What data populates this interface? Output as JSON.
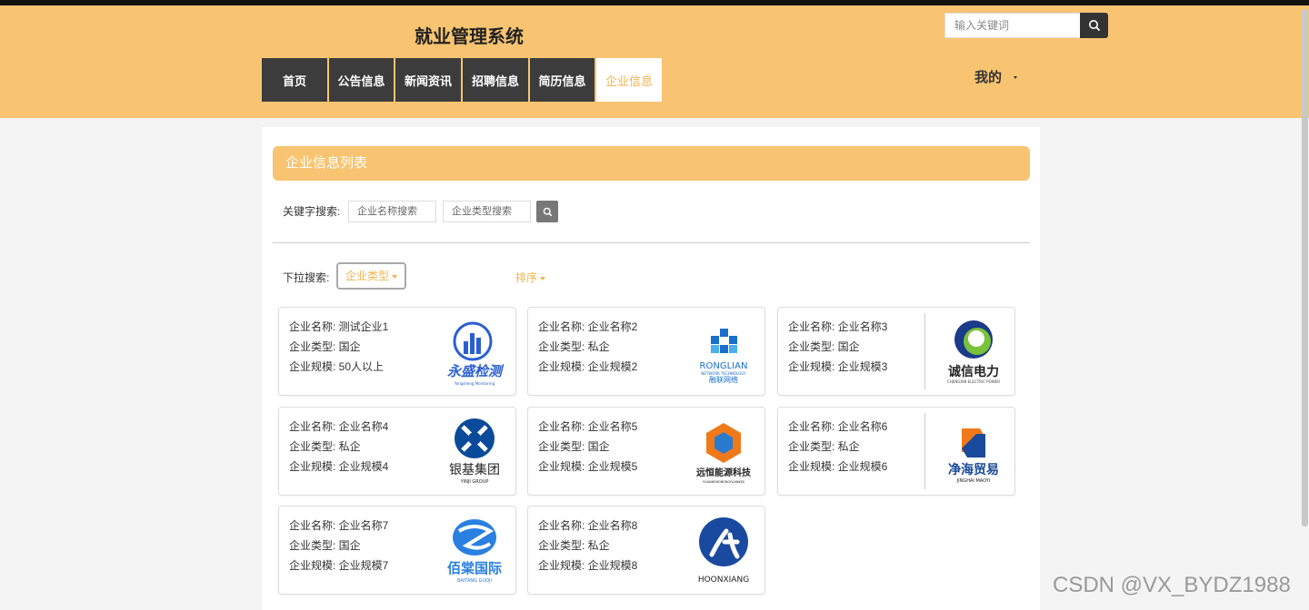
{
  "app": {
    "title": "就业管理系统",
    "search_placeholder": "输入关键词",
    "accent_color": "#f8c471",
    "nav_bg": "#3c3c3c"
  },
  "nav": {
    "items": [
      {
        "label": "首页",
        "active": false
      },
      {
        "label": "公告信息",
        "active": false
      },
      {
        "label": "新闻资讯",
        "active": false
      },
      {
        "label": "招聘信息",
        "active": false
      },
      {
        "label": "简历信息",
        "active": false
      },
      {
        "label": "企业信息",
        "active": true
      }
    ],
    "user_menu": "我的"
  },
  "list": {
    "title": "企业信息列表",
    "keyword_label": "关键字搜索:",
    "name_placeholder": "企业名称搜索",
    "type_placeholder": "企业类型搜索",
    "dropdown_label": "下拉搜索:",
    "type_dropdown": "企业类型",
    "sort_label": "排序"
  },
  "cards": [
    {
      "name": "企业名称: 测试企业1",
      "type": "企业类型: 国企",
      "scale": "企业规模: 50人以上",
      "logo": {
        "icon": "bar-chart-logo-icon",
        "text": "永盛检测",
        "sub": "Yongsheng Monitoring",
        "color": "#2a5fd0"
      }
    },
    {
      "name": "企业名称: 企业名称2",
      "type": "企业类型: 私企",
      "scale": "企业规模: 企业规模2",
      "logo": {
        "icon": "grid-star-logo-icon",
        "text": "融联网络",
        "sub": "RONGLIAN",
        "color": "#1a6fcc"
      }
    },
    {
      "name": "企业名称: 企业名称3",
      "type": "企业类型: 国企",
      "scale": "企业规模: 企业规模3",
      "logo": {
        "icon": "ring-logo-icon",
        "text": "诚信电力",
        "sub": "CHENGXIN ELECTRIC POWER",
        "color": "#1a3a8a"
      }
    },
    {
      "name": "企业名称: 企业名称4",
      "type": "企业类型: 私企",
      "scale": "企业规模: 企业规模4",
      "logo": {
        "icon": "x-circle-logo-icon",
        "text": "银基集团",
        "sub": "YINJI GROUP",
        "color": "#0a4a9a"
      }
    },
    {
      "name": "企业名称: 企业名称5",
      "type": "企业类型: 国企",
      "scale": "企业规模: 企业规模5",
      "logo": {
        "icon": "hexagon-logo-icon",
        "text": "远恒能源科技",
        "sub": "YUANHENGNENGYUANKEJI",
        "color": "#f07a1a"
      }
    },
    {
      "name": "企业名称: 企业名称6",
      "type": "企业类型: 私企",
      "scale": "企业规模: 企业规模6",
      "logo": {
        "icon": "chain-logo-icon",
        "text": "净海贸易",
        "sub": "JINGHAI MAOYI",
        "color": "#1a4a9a"
      }
    },
    {
      "name": "企业名称: 企业名称7",
      "type": "企业类型: 国企",
      "scale": "企业规模: 企业规模7",
      "logo": {
        "icon": "sphere-logo-icon",
        "text": "佰棠国际",
        "sub": "BAITANG GUOJI",
        "color": "#2a80e0"
      }
    },
    {
      "name": "企业名称: 企业名称8",
      "type": "企业类型: 私企",
      "scale": "企业规模: 企业规模8",
      "logo": {
        "icon": "wave-circle-logo-icon",
        "text": "",
        "sub": "HOONXIANG",
        "color": "#1a4aa0"
      }
    }
  ],
  "watermark": "CSDN @VX_BYDZ1988"
}
